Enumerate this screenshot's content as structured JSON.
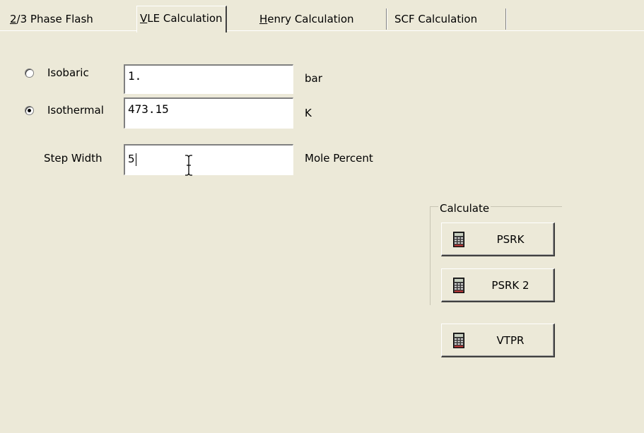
{
  "tabs": [
    {
      "prefix": "",
      "mnemonic": "2",
      "rest": "/3 Phase Flash",
      "selected": false
    },
    {
      "prefix": "",
      "mnemonic": "V",
      "rest": "LE Calculation",
      "selected": true
    },
    {
      "prefix": "",
      "mnemonic": "H",
      "rest": "enry Calculation",
      "selected": false
    },
    {
      "prefix": "SCF Calculation",
      "mnemonic": "",
      "rest": "",
      "selected": false
    }
  ],
  "mode": {
    "selected": "isothermal",
    "isobaric_label": "Isobaric",
    "isothermal_label": "Isothermal"
  },
  "fields": {
    "isobaric_value": "1.",
    "isobaric_unit": "bar",
    "isothermal_value": "473.15",
    "isothermal_unit": "K",
    "step_label": "Step Width",
    "step_value": "5",
    "step_unit": "Mole Percent"
  },
  "calculate": {
    "group_label": "Calculate",
    "buttons": [
      "PSRK",
      "PSRK 2",
      "VTPR"
    ],
    "icon": "calculator-icon"
  },
  "colors": {
    "background": "#ece9d8",
    "field": "#ffffff"
  }
}
